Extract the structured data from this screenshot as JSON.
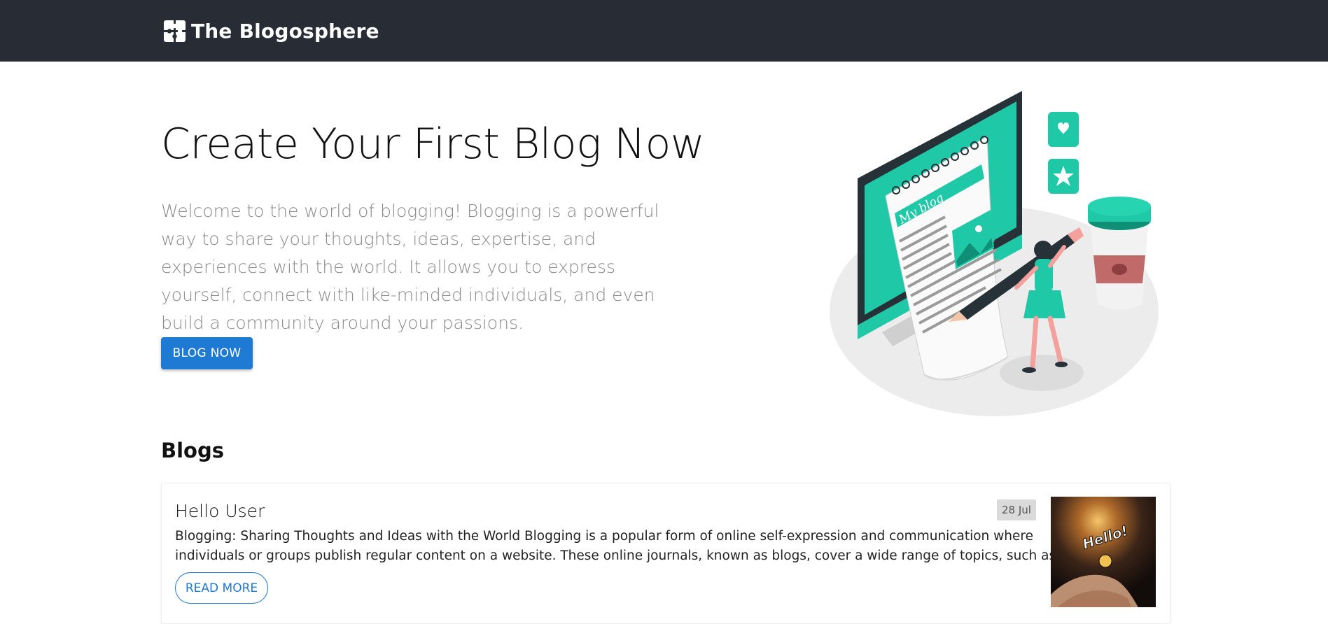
{
  "navbar": {
    "brand_label": "The Blogosphere",
    "brand_icon": "puzzle-logo-icon"
  },
  "hero": {
    "title": "Create Your First Blog Now",
    "lead": "Welcome to the world of blogging! Blogging is a powerful way to share your thoughts, ideas, expertise, and experiences with the world. It allows you to express yourself, connect with like-minded individuals, and even build a community around your passions.",
    "cta_label": "BLOG NOW",
    "illustration_text": "My blog"
  },
  "blogs": {
    "section_title": "Blogs",
    "items": [
      {
        "title": "Hello User",
        "date": "28 Jul",
        "excerpt_line1": "Blogging: Sharing Thoughts and Ideas with the World Blogging is a popular form of online self-expression and communication where",
        "excerpt_line2": "individuals or groups publish regular content on a website. These online journals, known as blogs, cover a wide range of topics, such as...",
        "read_more_label": "READ MORE",
        "thumbnail_text": "Hello!"
      }
    ]
  },
  "colors": {
    "navbar_bg": "#282c34",
    "primary": "#1f7ad4",
    "accent_teal": "#1fc8a7"
  }
}
